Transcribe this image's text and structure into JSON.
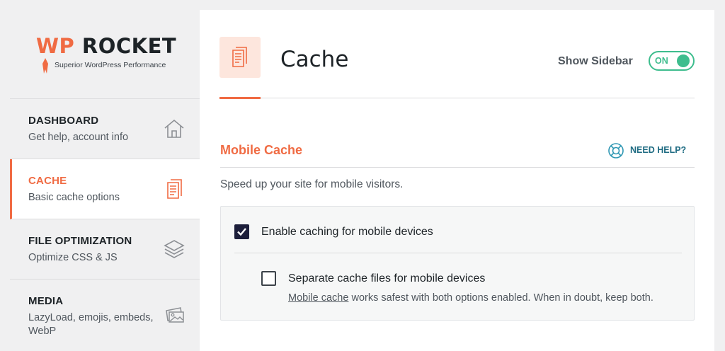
{
  "logo": {
    "wp": "WP",
    "rocket": "ROCKET",
    "tagline": "Superior WordPress Performance"
  },
  "nav": [
    {
      "title": "DASHBOARD",
      "desc": "Get help, account info",
      "icon": "home-icon"
    },
    {
      "title": "CACHE",
      "desc": "Basic cache options",
      "icon": "document-icon"
    },
    {
      "title": "FILE OPTIMIZATION",
      "desc": "Optimize CSS & JS",
      "icon": "layers-icon"
    },
    {
      "title": "MEDIA",
      "desc": "LazyLoad, emojis, embeds, WebP",
      "icon": "images-icon"
    }
  ],
  "header": {
    "title": "Cache",
    "sidebar_label": "Show Sidebar",
    "toggle_text": "ON"
  },
  "section": {
    "title": "Mobile Cache",
    "help": "NEED HELP?",
    "description": "Speed up your site for mobile visitors."
  },
  "options": {
    "enable_mobile": {
      "label": "Enable caching for mobile devices",
      "checked": true
    },
    "separate_files": {
      "label": "Separate cache files for mobile devices",
      "checked": false
    },
    "note_link": "Mobile cache",
    "note_text": " works safest with both options enabled. When in doubt, keep both."
  },
  "colors": {
    "accent": "#f06b43",
    "toggle_on": "#3ebd8e",
    "help_link": "#1e6b82",
    "checkbox_checked": "#1d1f3b"
  }
}
